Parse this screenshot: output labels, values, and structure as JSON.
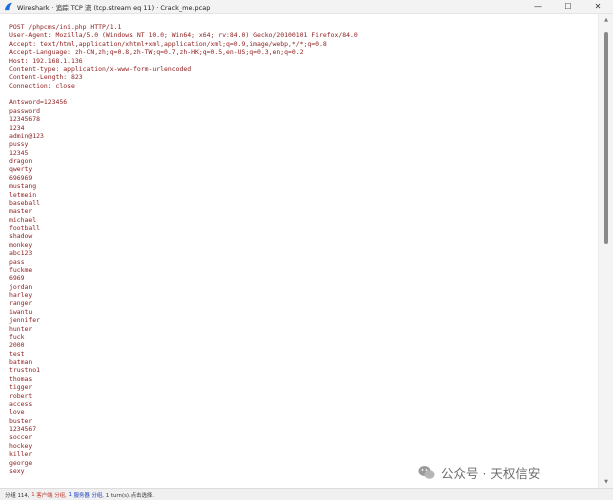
{
  "window": {
    "title": "Wireshark · 追踪 TCP 流 (tcp.stream eq 11) · Crack_me.pcap",
    "controls": {
      "minimize": "—",
      "maximize": "☐",
      "close": "✕"
    }
  },
  "stream": {
    "headers": [
      "POST /phpcms/ini.php HTTP/1.1",
      "User-Agent: Mozilla/5.0 (Windows NT 10.0; Win64; x64; rv:84.0) Gecko/20100101 Firefox/84.0",
      "Accept: text/html,application/xhtml+xml,application/xml;q=0.9,image/webp,*/*;q=0.8",
      "Accept-Language: zh-CN,zh;q=0.8,zh-TW;q=0.7,zh-HK;q=0.5,en-US;q=0.3,en;q=0.2",
      "Host: 192.168.1.136",
      "Content-type: application/x-www-form-urlencoded",
      "Content-Length: 823",
      "Connection: close"
    ],
    "body": [
      "Antsword=123456",
      "password",
      "12345678",
      "1234",
      "admin@123",
      "pussy",
      "12345",
      "dragon",
      "qwerty",
      "696969",
      "mustang",
      "letmein",
      "baseball",
      "master",
      "michael",
      "football",
      "shadow",
      "monkey",
      "abc123",
      "pass",
      "fuckme",
      "6969",
      "jordan",
      "harley",
      "ranger",
      "iwantu",
      "jennifer",
      "hunter",
      "fuck",
      "2000",
      "test",
      "batman",
      "trustno1",
      "thomas",
      "tigger",
      "robert",
      "access",
      "love",
      "buster",
      "1234567",
      "soccer",
      "hockey",
      "killer",
      "george",
      "sexy"
    ]
  },
  "statusbar": {
    "packets": "分组 114,",
    "client_count": "1",
    "client_label": "客户端 分组,",
    "server_count": "1",
    "server_label": "服务器 分组,",
    "turns": "1 turn(s).点击选择."
  },
  "watermark": {
    "text": "公众号 · 天权信安"
  },
  "colors": {
    "client_text": "#8e1b1b",
    "background": "#ffffff",
    "scroll_thumb": "#8a8a8a"
  }
}
